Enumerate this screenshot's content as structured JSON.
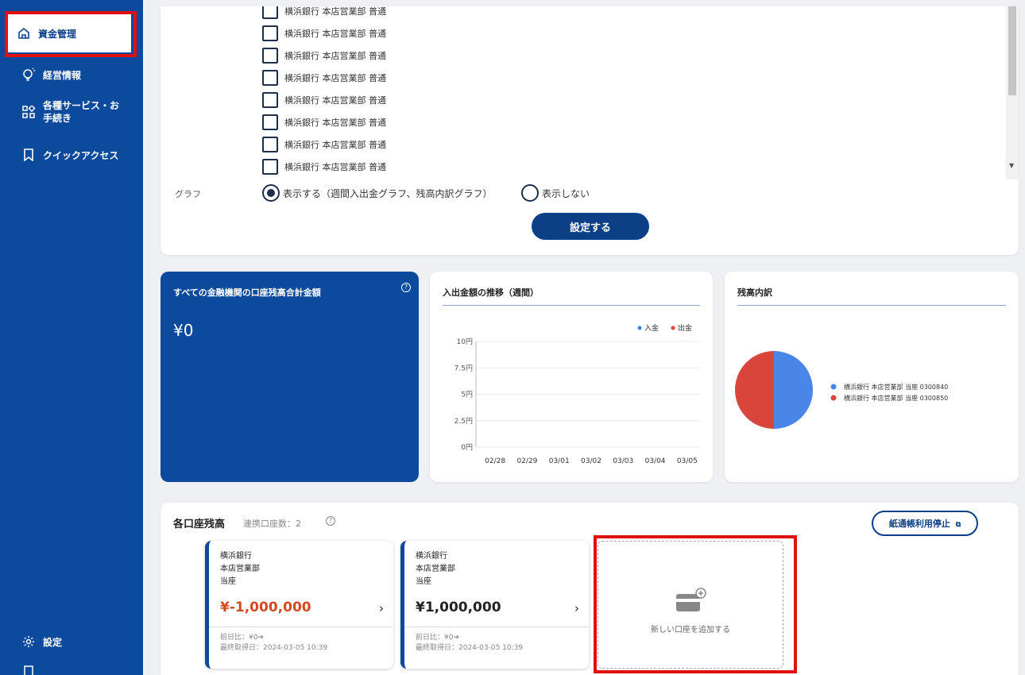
{
  "sidebar": {
    "items": [
      {
        "label": "資金管理",
        "icon": "home-icon"
      },
      {
        "label": "経営情報",
        "icon": "lightbulb-icon"
      },
      {
        "label": "各種サービス・お手続き",
        "label_line1": "各種サービス・お",
        "label_line2": "手続き",
        "icon": "grid-icon"
      },
      {
        "label": "クイックアクセス",
        "icon": "bookmark-icon"
      },
      {
        "label": "設定",
        "icon": "gear-icon"
      }
    ]
  },
  "settings_panel": {
    "accounts": [
      "横浜銀行 本店営業部 普通",
      "横浜銀行 本店営業部 普通",
      "横浜銀行 本店営業部 普通",
      "横浜銀行 本店営業部 普通",
      "横浜銀行 本店営業部 普通",
      "横浜銀行 本店営業部 普通",
      "横浜銀行 本店営業部 普通",
      "横浜銀行 本店営業部 普通"
    ],
    "graph_label": "グラフ",
    "radio_show": "表示する（週間入出金グラフ、残高内訳グラフ）",
    "radio_hide": "表示しない",
    "apply_button": "設定する"
  },
  "total": {
    "title": "すべての金融機関の口座残高合計金額",
    "help": "?",
    "amount": "¥0"
  },
  "trend": {
    "title": "入出金額の推移（週間）",
    "legend_in": "入金",
    "legend_out": "出金",
    "color_in": "#3b82f6",
    "color_out": "#d9453b"
  },
  "breakdown": {
    "title": "残高内訳"
  },
  "chart_data": [
    {
      "type": "line",
      "title": "入出金額の推移（週間）",
      "x": [
        "02/28",
        "02/29",
        "03/01",
        "03/02",
        "03/03",
        "03/04",
        "03/05"
      ],
      "y_ticks": [
        "10円",
        "7.5円",
        "5円",
        "2.5円",
        "0円"
      ],
      "ylim": [
        0,
        10
      ],
      "series": [
        {
          "name": "入金",
          "values": [
            0,
            0,
            0,
            0,
            0,
            0,
            0
          ]
        },
        {
          "name": "出金",
          "values": [
            0,
            0,
            0,
            0,
            0,
            0,
            0
          ]
        }
      ]
    },
    {
      "type": "pie",
      "title": "残高内訳",
      "slices": [
        {
          "label": "横浜銀行 本店営業部 当座 0300840",
          "value": 50,
          "color": "#4a86e8"
        },
        {
          "label": "横浜銀行 本店営業部 当座 0300850",
          "value": 50,
          "color": "#d9453b"
        }
      ]
    }
  ],
  "accounts_section": {
    "title": "各口座残高",
    "linked_count": "連携口座数：2",
    "help": "?",
    "passbook_button": "紙通帳利用停止",
    "cards": [
      {
        "bank": "横浜銀行",
        "branch": "本店営業部",
        "type": "当座",
        "amount": "¥-1,000,000",
        "amount_color": "#d14b1f",
        "prev_day": "前日比：¥0➔",
        "last_fetched": "最終取得日：2024-03-05 10:39"
      },
      {
        "bank": "横浜銀行",
        "branch": "本店営業部",
        "type": "当座",
        "amount": "¥1,000,000",
        "amount_color": "#222222",
        "prev_day": "前日比：¥0➔",
        "last_fetched": "最終取得日：2024-03-05 10:39"
      }
    ],
    "add_account": "新しい口座を追加する"
  }
}
